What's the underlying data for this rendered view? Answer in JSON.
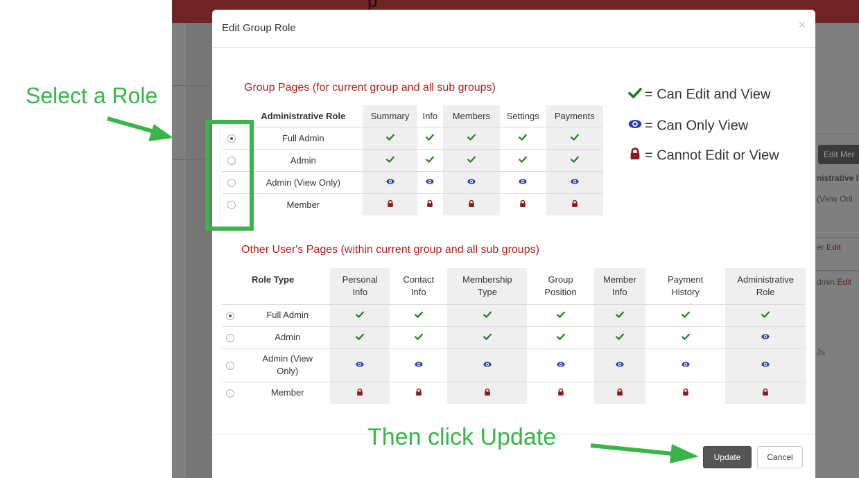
{
  "background": {
    "heading_fragment": "p",
    "edit_button": "Edit Mer",
    "col_header": "nistrative I",
    "rows": [
      {
        "text": "(View Onl",
        "link": ""
      },
      {
        "text": "er",
        "link": "Edit"
      },
      {
        "text": "dmin",
        "link": "Edit"
      },
      {
        "text": "Js",
        "link": ""
      }
    ]
  },
  "annotations": {
    "select_role": "Select a Role",
    "then_click": "Then click Update",
    "color": "#3ab54a"
  },
  "modal": {
    "title": "Edit Group Role",
    "close": "×",
    "group_section_title": "Group Pages (for current group and all sub groups)",
    "group_table": {
      "headers": [
        "Administrative Role",
        "Summary",
        "Info",
        "Members",
        "Settings",
        "Payments"
      ],
      "rows": [
        {
          "role": "Full Admin",
          "selected": true,
          "perms": [
            "edit",
            "edit",
            "edit",
            "edit",
            "edit"
          ]
        },
        {
          "role": "Admin",
          "selected": false,
          "perms": [
            "edit",
            "edit",
            "edit",
            "edit",
            "edit"
          ]
        },
        {
          "role": "Admin (View Only)",
          "selected": false,
          "perms": [
            "view",
            "view",
            "view",
            "view",
            "view"
          ]
        },
        {
          "role": "Member",
          "selected": false,
          "perms": [
            "lock",
            "lock",
            "lock",
            "lock",
            "lock"
          ]
        }
      ]
    },
    "legend": [
      {
        "icon": "check-icon",
        "text": "= Can Edit and View"
      },
      {
        "icon": "eye-icon",
        "text": "= Can Only View"
      },
      {
        "icon": "lock-icon",
        "text": "= Cannot Edit or View"
      }
    ],
    "other_section_title": "Other User's Pages (within current group and all sub groups)",
    "other_table": {
      "headers": [
        [
          "Role Type",
          ""
        ],
        [
          "Personal",
          "Info"
        ],
        [
          "Contact",
          "Info"
        ],
        [
          "Membership",
          "Type"
        ],
        [
          "Group",
          "Position"
        ],
        [
          "Member",
          "Info"
        ],
        [
          "Payment",
          "History"
        ],
        [
          "Administrative",
          "Role"
        ]
      ],
      "rows": [
        {
          "role": [
            "Full Admin"
          ],
          "selected": true,
          "perms": [
            "edit",
            "edit",
            "edit",
            "edit",
            "edit",
            "edit",
            "edit"
          ]
        },
        {
          "role": [
            "Admin"
          ],
          "selected": false,
          "perms": [
            "edit",
            "edit",
            "edit",
            "edit",
            "edit",
            "edit",
            "view"
          ]
        },
        {
          "role": [
            "Admin (View",
            "Only)"
          ],
          "selected": false,
          "perms": [
            "view",
            "view",
            "view",
            "view",
            "view",
            "view",
            "view"
          ]
        },
        {
          "role": [
            "Member"
          ],
          "selected": false,
          "perms": [
            "lock",
            "lock",
            "lock",
            "lock",
            "lock",
            "lock",
            "lock"
          ]
        }
      ]
    },
    "buttons": {
      "update": "Update",
      "cancel": "Cancel"
    },
    "colors": {
      "edit": "#1e7e1e",
      "view": "#2b3ea8",
      "lock": "#8b1a1a",
      "section_title": "#b22222"
    }
  }
}
